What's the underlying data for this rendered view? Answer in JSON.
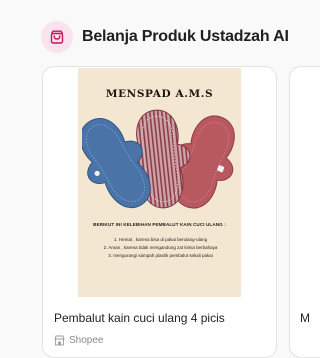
{
  "section": {
    "title": "Belanja Produk Ustadzah AI",
    "icon": "shopping-bag-icon",
    "accent_bg": "#fbe2ef",
    "accent": "#c2185b"
  },
  "products": [
    {
      "image": {
        "brand": "MENSPAD A.M.S",
        "heading": "BERIKUT INI KELEBIHAN PEMBALUT KAIN CUCI ULANG :",
        "points": [
          "1. Hemat , karena bisa di pakai berulang-ulang",
          "2. Aman , karena tidak mengandung zat kimia berbahaya",
          "3. mengurangi sampah plastik pembalut sekali pakai"
        ],
        "pad_colors": [
          "#4a73a8",
          "#c9939a",
          "#b8585f"
        ],
        "background": "#f4e7d2"
      },
      "title": "Pembalut kain cuci ulang 4 picis",
      "seller": "Shopee",
      "seller_icon": "store-icon"
    },
    {
      "title": "M"
    }
  ]
}
